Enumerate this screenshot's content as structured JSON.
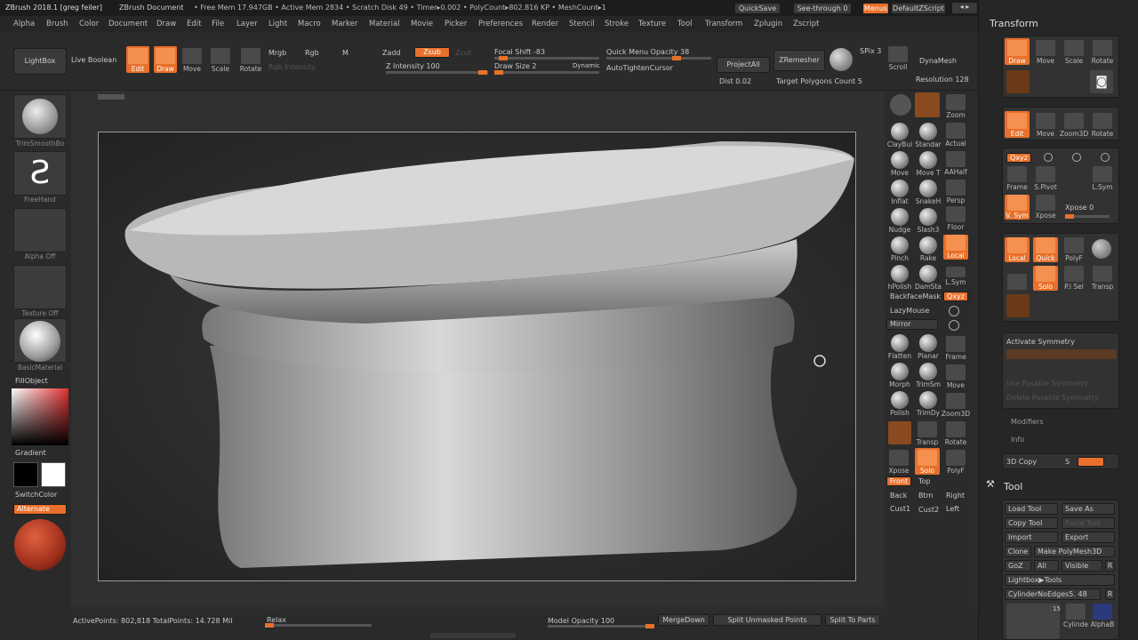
{
  "titlebar": {
    "app": "ZBrush 2018.1 [greg feiler]",
    "doc": "ZBrush Document",
    "status": "• Free Mem 17.947GB • Active Mem 2834 • Scratch Disk 49 • Timer▸0.002 • PolyCount▸802.816 KP • MeshCount▸1",
    "quicksave": "QuickSave",
    "seethrough": "See-through  0",
    "menus": "Menus",
    "zscript": "DefaultZScript"
  },
  "menu": [
    "Alpha",
    "Brush",
    "Color",
    "Document",
    "Draw",
    "Edit",
    "File",
    "Layer",
    "Light",
    "Macro",
    "Marker",
    "Material",
    "Movie",
    "Picker",
    "Preferences",
    "Render",
    "Stencil",
    "Stroke",
    "Texture",
    "Tool",
    "Transform",
    "Zplugin",
    "Zscript"
  ],
  "toolbar": {
    "lightbox": "LightBox",
    "liveboolean": "Live Boolean",
    "edit": "Edit",
    "draw": "Draw",
    "move": "Move",
    "scale": "Scale",
    "rotate": "Rotate",
    "mrgb": "Mrgb",
    "rgb": "Rgb",
    "m": "M",
    "rgb_intensity": "Rgb Intensity",
    "zadd": "Zadd",
    "zsub": "Zsub",
    "zcut": "Zcut",
    "z_intensity": "Z Intensity 100",
    "focal_shift": "Focal Shift -83",
    "draw_size": "Draw Size 2",
    "dynamic": "Dynamic",
    "quick_menu_opacity": "Quick Menu Opacity 38",
    "autotighten": "AutoTightenCursor",
    "projectall": "ProjectAll",
    "dist": "Dist 0.02",
    "zremesher": "ZRemesher",
    "target_poly": "Target Polygons Count 5",
    "spix": "SPix 3",
    "scroll": "Scroll",
    "dynamesh": "DynaMesh",
    "resolution": "Resolution 128"
  },
  "leftshelf": {
    "brush": "TrimSmoothBo",
    "stroke": "FreeHand",
    "alpha": "Alpha Off",
    "texture": "Texture Off",
    "material": "BasicMaterial",
    "fillobject": "FillObject",
    "gradient": "Gradient",
    "switchcolor": "SwitchColor",
    "alternate": "Alternate"
  },
  "brushes": [
    "ClayBui",
    "Standar",
    "Move",
    "Move T",
    "Inflat",
    "SnakeH",
    "Nudge",
    "Slash3",
    "Pinch",
    "Rake",
    "hPolish",
    "DamSta"
  ],
  "brushes2": [
    "Flatten",
    "Planar",
    "Morph",
    "TrimSm",
    "Polish",
    "TrimDy"
  ],
  "shelfcol3": [
    "Zoom",
    "Actual",
    "AAHalf",
    "Persp",
    "Floor",
    "Local",
    "L.Sym",
    "Qxyz"
  ],
  "shelfcol3b": [
    "Frame",
    "Move",
    "Zoom3D",
    "Rotate",
    "PolyF"
  ],
  "shelflabels": {
    "backfacemask": "BackfaceMask",
    "lazymouse": "LazyMouse",
    "mirror": "Mirror",
    "transp": "Transp",
    "xpose": "Xpose",
    "solo": "Solo",
    "front": "Front",
    "top": "Top",
    "back": "Back",
    "btm": "Btm",
    "right": "Right",
    "cust1": "Cust1",
    "cust2": "Cust2",
    "left": "Left"
  },
  "transform": {
    "title": "Transform",
    "row1": [
      "Draw",
      "Move",
      "Scale",
      "Rotate"
    ],
    "row2": [
      "Edit",
      "Move",
      "Zoom3D",
      "Rotate"
    ],
    "row3": [
      "Frame",
      "S.Pivot",
      "",
      "L.Sym"
    ],
    "row4": [
      "V. Sym",
      "Xpose",
      "Xpose 0"
    ],
    "row5": [
      "Local",
      "Quick",
      "PolyF",
      ""
    ],
    "row6": [
      "",
      "Solo",
      "P.l Sel",
      "Transp"
    ],
    "activate_symmetry": "Activate Symmetry",
    "use_posable": "Use Posable Symmetry",
    "delete_posable": "Delete Posable Symmetry",
    "modifiers": "Modifiers",
    "info": "Info",
    "copy3d": "3D Copy",
    "copy3d_s": "S"
  },
  "tool": {
    "title": "Tool",
    "load": "Load Tool",
    "saveas": "Save As",
    "copy": "Copy Tool",
    "paste": "Paste Tool",
    "import": "Import",
    "export": "Export",
    "clone": "Clone",
    "makepoly": "Make PolyMesh3D",
    "goz": "GoZ",
    "all": "All",
    "visible": "Visible",
    "r": "R",
    "lightboxtools": "Lightbox▶Tools",
    "current": "CylinderNoEdges5. 48",
    "thumbs": [
      "Cylinde",
      "AlphaB"
    ],
    "count": "15"
  },
  "bottom": {
    "activepoints": "ActivePoints: 802,818  TotalPoints: 14.728 Mil",
    "relax": "Relax",
    "model_opacity": "Model Opacity 100",
    "mergedown": "MergeDown",
    "split_unmasked": "Split Unmasked Points",
    "split_parts": "Split To Parts"
  },
  "colors": {
    "accent": "#e8702a",
    "bg": "#2c2c2c",
    "panel": "#262626"
  }
}
